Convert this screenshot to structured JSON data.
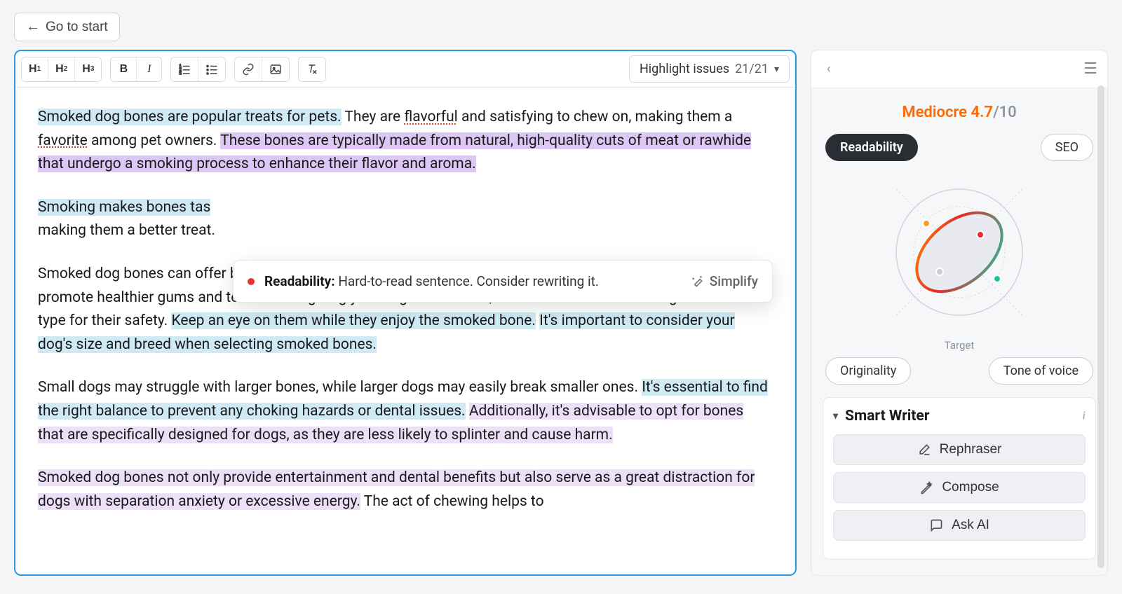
{
  "header": {
    "go_to_start": "Go to start"
  },
  "toolbar": {
    "h1": "H",
    "h2": "H",
    "h3": "H",
    "highlight_label": "Highlight issues",
    "highlight_count": "21/21"
  },
  "content": {
    "p1_a": "Smoked dog bones are popular treats for pets.",
    "p1_b": " They are ",
    "p1_flavorful": "flavorful",
    "p1_c": " and satisfying to chew on, making them a ",
    "p1_favorite": "favorite",
    "p1_d": " among pet owners. ",
    "p1_e": "These bones are typically made from natural, high-quality cuts of meat or rawhide that undergo a smoking process to enhance their flavor and aroma.",
    "p2_a": "Smoking makes bones tas",
    "p2_b": "making them a better treat.",
    "p3_a": "Smoked dog bones can offer both entertainment and dental benefits for dogs, as the act of chewing can help promote healthier gums and teeth. When giving your dog a bone treat, make sure to choose the right size and type for their safety. ",
    "p3_b": "Keep an eye on them while they enjoy the smoked bone.",
    "p3_c": " ",
    "p3_d": "It's important to consider your dog's size and breed when selecting smoked bones.",
    "p4_a": "Small dogs may struggle with larger bones, while larger dogs may easily break smaller ones. ",
    "p4_b": "It's essential to find the right balance to prevent any choking hazards or dental issues.",
    "p4_c": " ",
    "p4_d": "Additionally, it's advisable to opt for bones that are specifically designed for dogs, as they are less likely to splinter and cause harm.",
    "p5_a": "Smoked dog bones not only provide entertainment and dental benefits but also serve as a great distraction for dogs with separation anxiety or excessive energy.",
    "p5_b": " The act of chewing helps to"
  },
  "popup": {
    "label": "Readability:",
    "message": "Hard-to-read sentence. Consider rewriting it.",
    "action": "Simplify"
  },
  "sidebar": {
    "score_label": "Mediocre",
    "score_value": "4.7",
    "score_max": "/10",
    "pills": {
      "readability": "Readability",
      "seo": "SEO",
      "originality": "Originality",
      "tone": "Tone of voice"
    },
    "target_label": "Target",
    "smart_writer": {
      "title": "Smart Writer",
      "rephraser": "Rephraser",
      "compose": "Compose",
      "ask_ai": "Ask AI"
    }
  }
}
